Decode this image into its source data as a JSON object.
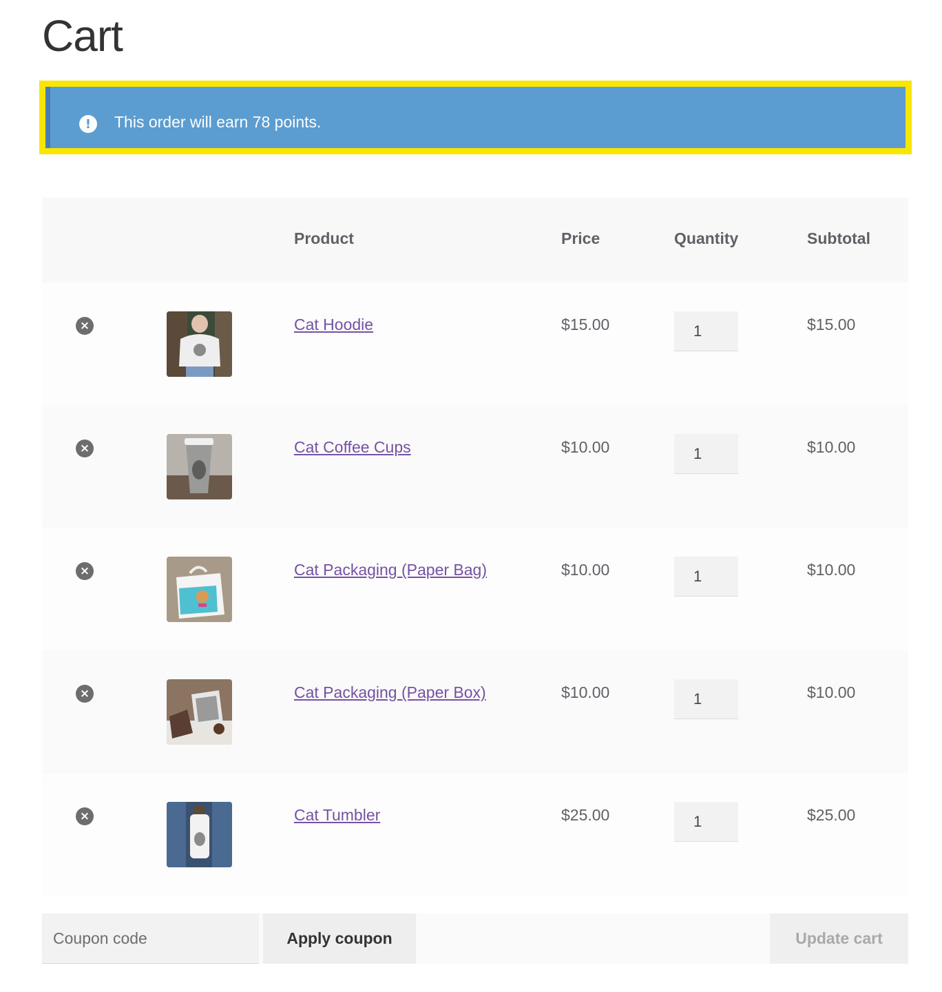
{
  "page": {
    "title": "Cart"
  },
  "notice": {
    "icon": "exclamation-circle-icon",
    "text": "This order will earn 78 points.",
    "bg_color": "#5b9dd0",
    "highlight_color": "#f8e600"
  },
  "table": {
    "headers": {
      "product": "Product",
      "price": "Price",
      "quantity": "Quantity",
      "subtotal": "Subtotal"
    },
    "items": [
      {
        "name": "Cat Hoodie",
        "price": "$15.00",
        "quantity": "1",
        "subtotal": "$15.00",
        "image_icon": "hoodie-thumbnail"
      },
      {
        "name": "Cat Coffee Cups",
        "price": "$10.00",
        "quantity": "1",
        "subtotal": "$10.00",
        "image_icon": "coffee-cup-thumbnail"
      },
      {
        "name": "Cat Packaging (Paper Bag)",
        "price": "$10.00",
        "quantity": "1",
        "subtotal": "$10.00",
        "image_icon": "paper-bag-thumbnail"
      },
      {
        "name": "Cat Packaging (Paper Box)",
        "price": "$10.00",
        "quantity": "1",
        "subtotal": "$10.00",
        "image_icon": "paper-box-thumbnail"
      },
      {
        "name": "Cat Tumbler",
        "price": "$25.00",
        "quantity": "1",
        "subtotal": "$25.00",
        "image_icon": "tumbler-thumbnail"
      }
    ]
  },
  "actions": {
    "coupon_placeholder": "Coupon code",
    "apply_label": "Apply coupon",
    "update_label": "Update cart"
  },
  "colors": {
    "link": "#7451a3",
    "remove": "#6d6d6d"
  }
}
